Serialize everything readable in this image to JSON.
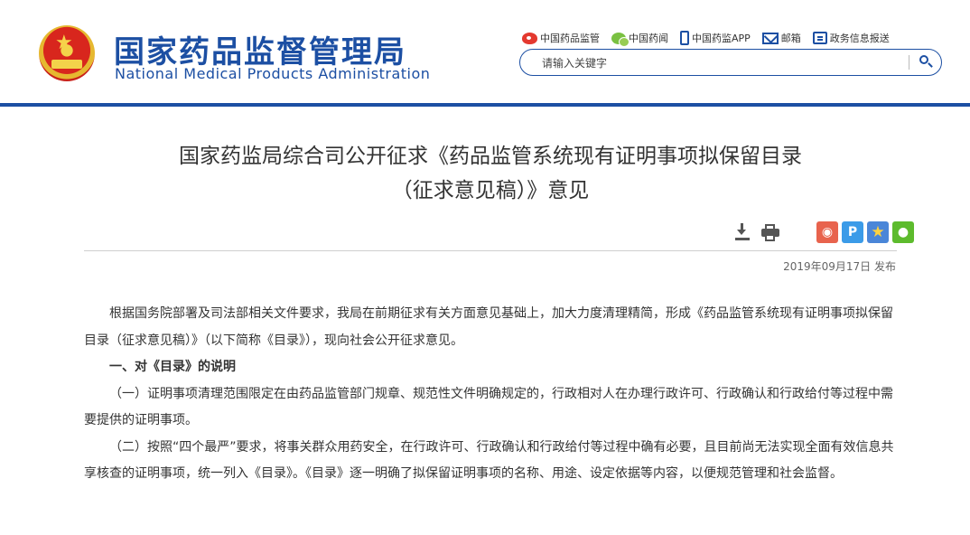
{
  "header": {
    "logo_cn": "国家药品监督管理局",
    "logo_en": "National Medical Products Administration",
    "links": [
      {
        "label": "中国药品监管",
        "icon": "weibo-icon"
      },
      {
        "label": "中国药闻",
        "icon": "wechat-icon"
      },
      {
        "label": "中国药监APP",
        "icon": "mobile-app-icon"
      },
      {
        "label": "邮箱",
        "icon": "mail-icon"
      },
      {
        "label": "政务信息报送",
        "icon": "report-icon"
      }
    ],
    "search": {
      "placeholder": "请输入关键字"
    }
  },
  "colors": {
    "brand_blue": "#1c4fa3",
    "emblem_red": "#d8261d"
  },
  "article": {
    "title_line1": "国家药监局综合司公开征求《药品监管系统现有证明事项拟保留目录",
    "title_line2": "（征求意见稿）》意见",
    "publish_date": "2019年09月17日 发布",
    "share_icons": [
      "weibo-share-icon",
      "qzone-share-icon",
      "favorite-star-icon",
      "wechat-share-icon"
    ],
    "paragraphs": [
      {
        "text": "根据国务院部署及司法部相关文件要求，我局在前期征求有关方面意见基础上，加大力度清理精简，形成《药品监管系统现有证明事项拟保留目录（征求意见稿）》（以下简称《目录》），现向社会公开征求意见。",
        "bold": false
      },
      {
        "text": "一、对《目录》的说明",
        "bold": true
      },
      {
        "text": "（一）证明事项清理范围限定在由药品监管部门规章、规范性文件明确规定的，行政相对人在办理行政许可、行政确认和行政给付等过程中需要提供的证明事项。",
        "bold": false
      },
      {
        "text": "（二）按照“四个最严”要求，将事关群众用药安全，在行政许可、行政确认和行政给付等过程中确有必要，且目前尚无法实现全面有效信息共享核查的证明事项，统一列入《目录》。《目录》逐一明确了拟保留证明事项的名称、用途、设定依据等内容，以便规范管理和社会监督。",
        "bold": false
      }
    ]
  }
}
